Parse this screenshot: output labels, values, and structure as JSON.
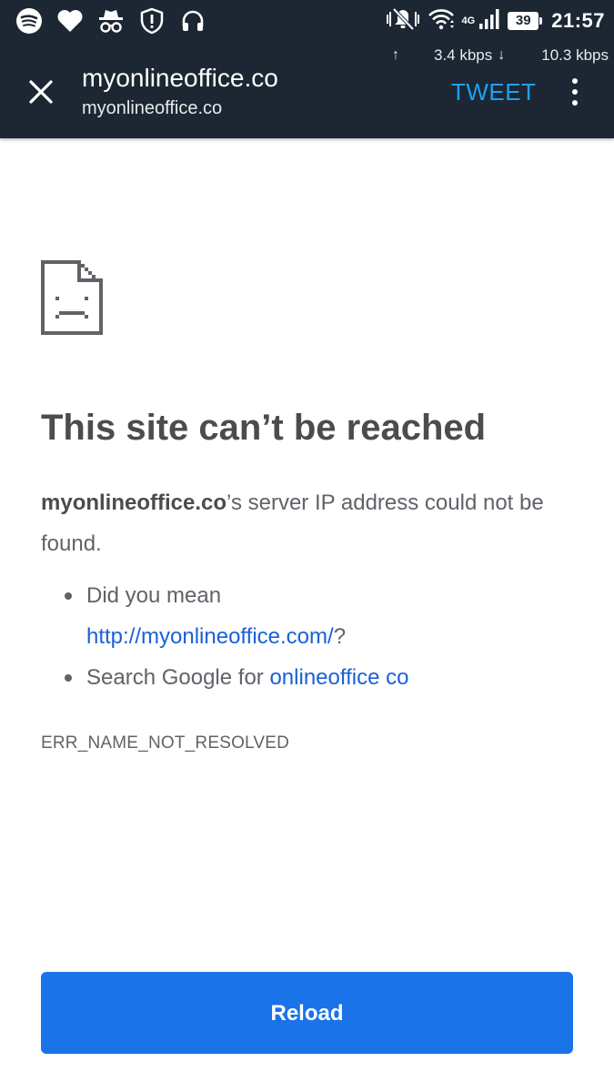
{
  "status_bar": {
    "network_type": "4G",
    "battery_level": "39",
    "time": "21:57",
    "icons": [
      "spotify-icon",
      "heart-icon",
      "incognito-icon",
      "shield-alert-icon",
      "headphones-icon",
      "mute-icon",
      "wifi-icon",
      "signal-icon",
      "battery-icon"
    ]
  },
  "toolbar": {
    "upload_speed": "3.4 kbps",
    "download_speed": "10.3 kbps",
    "title": "myonlineoffice.co",
    "url": "myonlineoffice.co",
    "tweet_label": "TWEET",
    "close_icon": "close-icon",
    "menu_icon": "more-vert-icon",
    "tweet_color": "#1da1f2",
    "background_color": "#1c2733"
  },
  "error": {
    "icon": "sad-document-icon",
    "title": "This site can’t be reached",
    "host": "myonlineoffice.co",
    "message": "’s server IP address could not be found.",
    "suggestions": {
      "did_you_mean_prefix": "Did you mean",
      "did_you_mean_link": "http://myonlineoffice.com/",
      "did_you_mean_suffix": "?",
      "search_prefix": "Search Google for ",
      "search_link": "onlineoffice co"
    },
    "code": "ERR_NAME_NOT_RESOLVED",
    "link_color": "#1a61d6"
  },
  "reload": {
    "label": "Reload",
    "color": "#1a73e8"
  }
}
